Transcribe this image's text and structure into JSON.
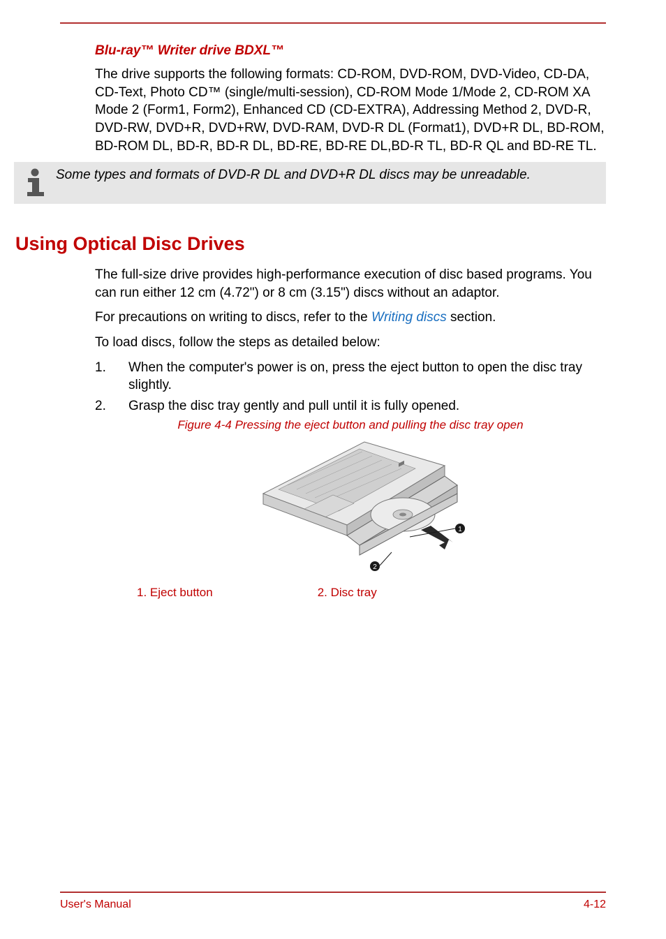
{
  "heading_bluray": "Blu-ray™ Writer drive BDXL™",
  "bluray_para": "The drive supports the following formats: CD-ROM, DVD-ROM, DVD-Video, CD-DA, CD-Text, Photo CD™ (single/multi-session), CD-ROM Mode 1/Mode 2, CD-ROM XA Mode 2 (Form1, Form2), Enhanced CD (CD-EXTRA), Addressing Method 2, DVD-R, DVD-RW, DVD+R, DVD+RW, DVD-RAM, DVD-R DL (Format1), DVD+R DL, BD-ROM, BD-ROM DL, BD-R, BD-R DL, BD-RE, BD-RE DL,BD-R TL, BD-R QL and BD-RE TL.",
  "note_text": "Some types and formats of DVD-R DL and DVD+R DL discs may be unreadable.",
  "heading_using": "Using Optical Disc Drives",
  "using_para1": "The full-size drive provides high-performance execution of disc based programs. You can run either 12 cm (4.72\") or 8 cm (3.15\") discs without an adaptor.",
  "precautions_prefix": "For precautions on writing to discs, refer to the ",
  "precautions_link": "Writing discs",
  "precautions_suffix": " section.",
  "load_intro": "To load discs, follow the steps as detailed below:",
  "steps": {
    "s1": {
      "num": "1.",
      "text": "When the computer's power is on, press the eject button to open the disc tray slightly."
    },
    "s2": {
      "num": "2.",
      "text": "Grasp the disc tray gently and pull until it is fully opened."
    }
  },
  "figure_caption": "Figure 4-4 Pressing the eject button and pulling the disc tray open",
  "legend": {
    "l1": "1. Eject button",
    "l2": "2. Disc tray"
  },
  "footer": {
    "left": "User's Manual",
    "right": "4-12"
  }
}
